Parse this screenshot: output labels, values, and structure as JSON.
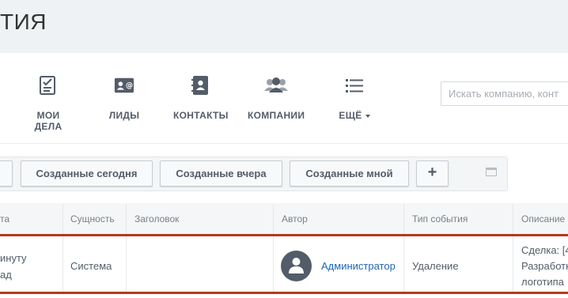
{
  "header": {
    "title": "ТИЯ"
  },
  "toolbar": {
    "items": [
      {
        "label": "МОИ ДЕЛА",
        "icon": "checklist-icon"
      },
      {
        "label": "ЛИДЫ",
        "icon": "lead-card-icon"
      },
      {
        "label": "КОНТАКТЫ",
        "icon": "contact-book-icon"
      },
      {
        "label": "КОМПАНИИ",
        "icon": "people-group-icon"
      },
      {
        "label": "ЕЩЁ",
        "icon": "list-icon"
      }
    ],
    "search_placeholder": "Искать компанию, конт"
  },
  "filters": {
    "buttons": [
      "Созданные сегодня",
      "Созданные вчера",
      "Созданные мной"
    ],
    "add_label": "+"
  },
  "table": {
    "columns": [
      "та",
      "Сущность",
      "Заголовок",
      "Автор",
      "Тип события",
      "Описание"
    ],
    "rows": [
      {
        "date_line1": "инуту",
        "date_line2": "ад",
        "entity": "Система",
        "title": "",
        "author": "Администратор",
        "event_type": "Удаление",
        "desc_line1": "Сделка: [4",
        "desc_line2": "Разработк",
        "desc_line3": "логотипа"
      }
    ]
  },
  "colors": {
    "accent": "#2067b0",
    "row_border": "#b23b1f",
    "header_bg": "#eef2f4"
  }
}
